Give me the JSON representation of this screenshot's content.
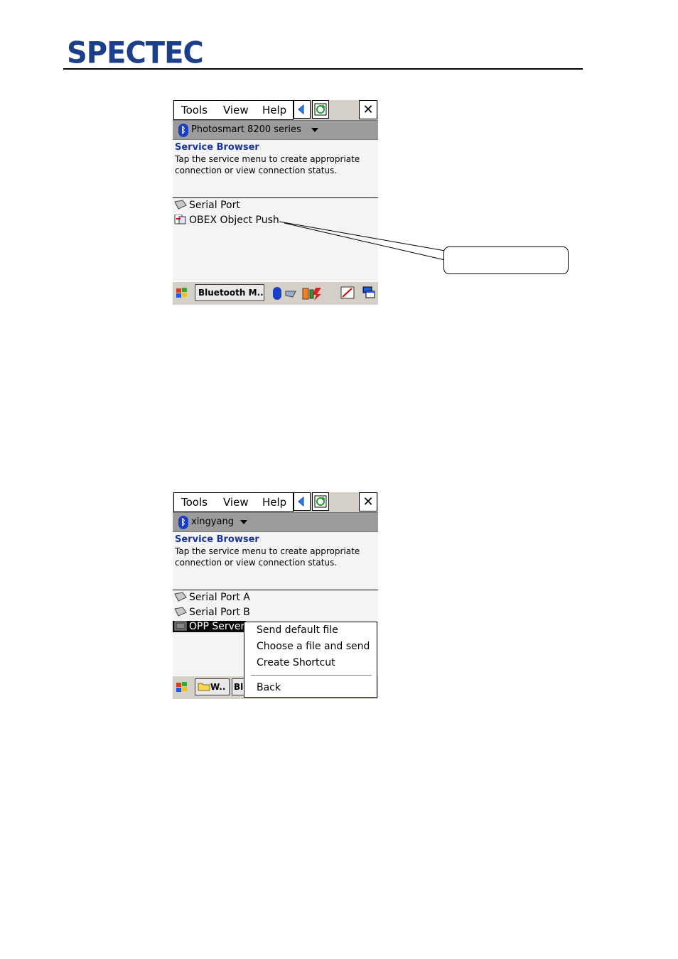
{
  "header": {
    "logo_text": "SPECTEC",
    "logo_color": "#1c3f8c"
  },
  "screens": [
    {
      "menu": {
        "tools": "Tools",
        "view": "View",
        "help": "Help",
        "close": "✕"
      },
      "device": "Photosmart 8200 series",
      "title": "Service Browser",
      "description": "Tap the service menu to create appropriate connection or view connection status.",
      "services": [
        "Serial Port",
        "OBEX Object Push"
      ],
      "taskbar": {
        "task_label": "Bluetooth M..."
      }
    },
    {
      "menu": {
        "tools": "Tools",
        "view": "View",
        "help": "Help",
        "close": "✕"
      },
      "device": "xingyang",
      "title": "Service Browser",
      "description": "Tap the service menu to create appropriate connection or view connection status.",
      "services": [
        "Serial Port A",
        "Serial Port B",
        "OPP Server"
      ],
      "taskbar": {
        "task1_label": "W..",
        "task2_label": "Bl"
      },
      "context_menu": [
        "Send default file",
        "Choose a file and send",
        "Create Shortcut",
        "Back"
      ]
    }
  ],
  "colors": {
    "accent": "#1933a0",
    "bluetooth": "#1a3fc7",
    "bar_gray": "#9c9c9c"
  }
}
